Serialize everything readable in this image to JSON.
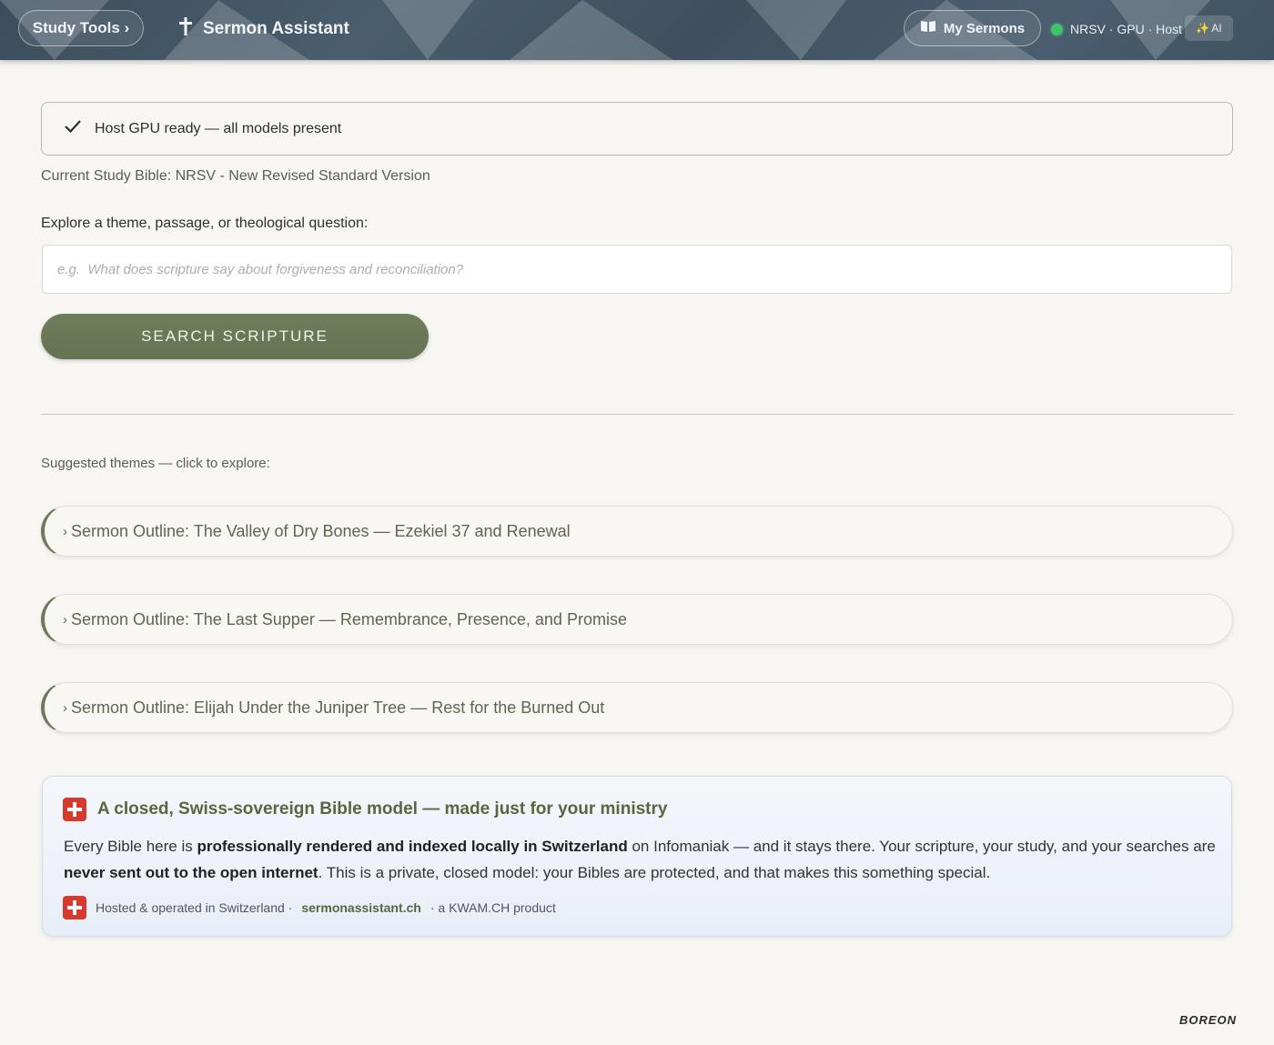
{
  "header": {
    "study_tools_label": "Study Tools ›",
    "app_title": "Sermon Assistant",
    "my_sermons_label": "My Sermons",
    "status_text": "NRSV · GPU · Host",
    "ai_badge_label": "AI"
  },
  "main": {
    "ready_message": "Host GPU ready — all models present",
    "current_bible": "Current Study Bible: NRSV - New Revised Standard Version",
    "explore_label": "Explore a theme, passage, or theological question:",
    "search_placeholder": "e.g.  What does scripture say about forgiveness and reconciliation?",
    "search_button_label": "SEARCH SCRIPTURE",
    "suggested_label": "Suggested themes — click to explore:",
    "themes": [
      "Sermon Outline: The Valley of Dry Bones — Ezekiel 37 and Renewal",
      "Sermon Outline: The Last Supper — Remembrance, Presence, and Promise",
      "Sermon Outline: Elijah Under the Juniper Tree — Rest for the Burned Out"
    ]
  },
  "info_card": {
    "title": "A closed, Swiss-sovereign Bible model — made just for your ministry",
    "body_1": "Every Bible here is ",
    "body_bold_1": "professionally rendered and indexed locally in Switzerland",
    "body_2": " on Infomaniak — and it stays there. Your scripture, your study, and your searches are ",
    "body_bold_2": "never sent out to the open internet",
    "body_3": ". This is a private, closed model: your Bibles are protected, and that makes this something special.",
    "footer_prefix": "Hosted & operated in Switzerland ·",
    "footer_site": "sermonassistant.ch",
    "footer_suffix": "· a KWAM.CH product"
  },
  "watermark": "BOREON",
  "colors": {
    "accent_olive": "#6c7a5a",
    "header_slate": "#44576a",
    "status_green": "#3ec46d",
    "swiss_red": "#d63a2f"
  }
}
